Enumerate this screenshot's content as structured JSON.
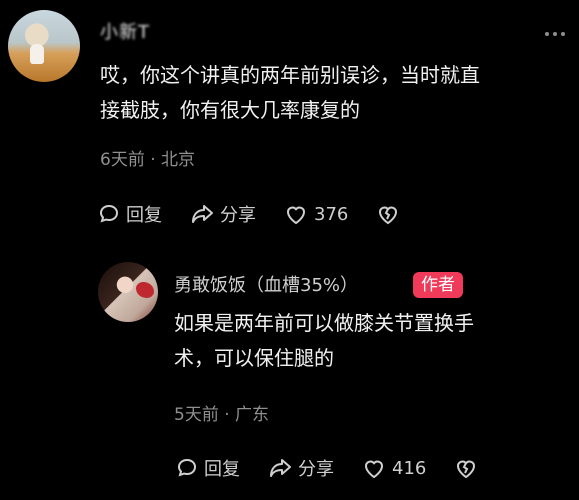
{
  "comments": [
    {
      "username": "小新T",
      "text_line1": "哎，你这个讲真的两年前别误诊，当时就直",
      "text_line2": "接截肢，你有很大几率康复的",
      "meta": "6天前 · 北京",
      "reply_label": "回复",
      "share_label": "分享",
      "like_count": "376"
    },
    {
      "username": "勇敢饭饭（血槽35%）",
      "badge": "作者",
      "text_line1": "如果是两年前可以做膝关节置换手",
      "text_line2": "术，可以保住腿的",
      "meta": "5天前 · 广东",
      "reply_label": "回复",
      "share_label": "分享",
      "like_count": "416"
    }
  ],
  "colors": {
    "background": "#000000",
    "badge": "#f03a5a",
    "meta": "#8f8f8f"
  }
}
